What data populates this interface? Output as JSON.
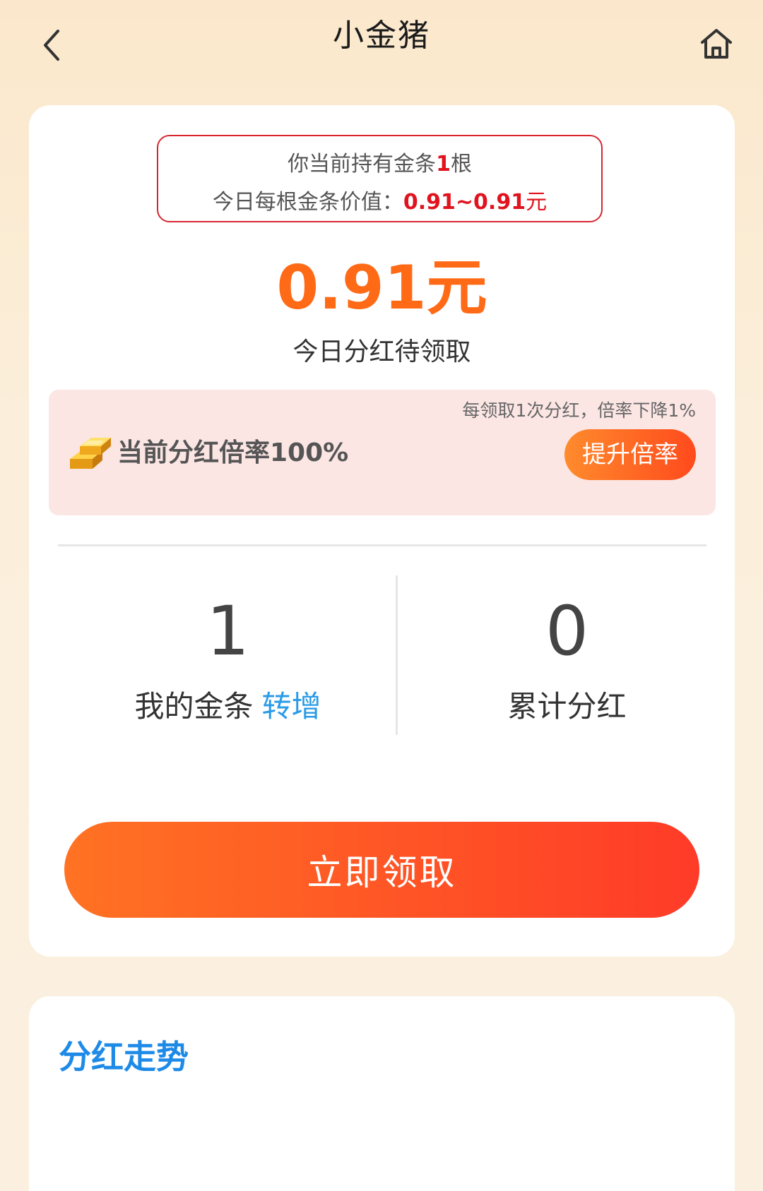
{
  "header": {
    "title": "小金猪"
  },
  "holding": {
    "line1_prefix": "你当前持有金条",
    "count": "1",
    "line1_suffix": "根",
    "line2_prefix": "今日每根金条价值：",
    "value_range": "0.91~0.91",
    "line2_suffix": "元"
  },
  "dividend": {
    "amount": "0.91元",
    "caption": "今日分红待领取"
  },
  "rate": {
    "note": "每领取1次分红，倍率下降1%",
    "text": "当前分红倍率100%",
    "boost_label": "提升倍率"
  },
  "stats": {
    "gold_count": "1",
    "gold_label": "我的金条",
    "transfer_label": "转增",
    "total_dividend": "0",
    "total_label": "累计分红"
  },
  "claim": {
    "label": "立即领取"
  },
  "trend": {
    "title": "分红走势"
  },
  "colors": {
    "accent_orange": "#ff6a17",
    "accent_red": "#e0131e",
    "link_blue": "#2a9be6",
    "title_blue": "#1e8ae8"
  }
}
